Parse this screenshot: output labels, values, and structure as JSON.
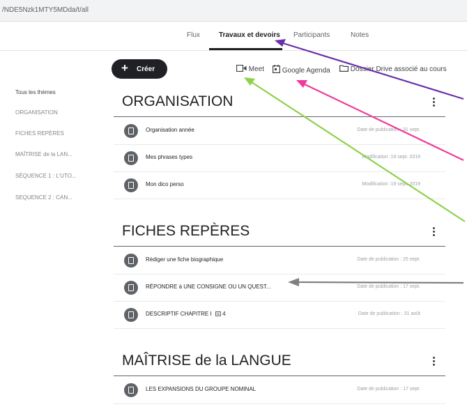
{
  "browser": {
    "url": "/NDE5Nzk1MTY5MDda/t/all"
  },
  "tabs": [
    {
      "label": "Flux"
    },
    {
      "label": "Travaux et devoirs"
    },
    {
      "label": "Participants"
    },
    {
      "label": "Notes"
    }
  ],
  "toolbar": {
    "create_label": "Créer",
    "meet_label": "Meet",
    "agenda_label": "Google Agenda",
    "drive_label": "Dossier Drive associé au cours"
  },
  "sidebar": {
    "items": [
      {
        "label": "Tous les thèmes"
      },
      {
        "label": "ORGANISATION"
      },
      {
        "label": "FICHES REPÈRES"
      },
      {
        "label": "MAÎTRISE de la LAN..."
      },
      {
        "label": "SÉQUENCE 1 : L'UTO..."
      },
      {
        "label": "SEQUENCE 2 : CAN..."
      }
    ]
  },
  "sections": [
    {
      "title": "ORGANISATION",
      "rows": [
        {
          "title": "Organisation année",
          "date": "Date de publication : 31 sept."
        },
        {
          "title": "Mes phrases types",
          "date": "Modification :19 sept. 2019"
        },
        {
          "title": "Mon dico perso",
          "date": "Modification :19 sept. 2019"
        }
      ]
    },
    {
      "title": "FICHES REPÈRES",
      "rows": [
        {
          "title": "Rédiger une fiche biographique",
          "date": "Date de publication : 25 sept."
        },
        {
          "title": "RÉPONDRE à UNE CONSIGNE OU UN QUEST...",
          "date": "Date de publication : 17 sept."
        },
        {
          "title": "DESCRIPTIF CHAPITRE I",
          "extra": "4",
          "date": "Date de publication : 31 août"
        }
      ]
    },
    {
      "title": "MAÎTRISE de la LANGUE",
      "rows": [
        {
          "title": "LES EXPANSIONS DU GROUPE NOMINAL",
          "date": "Date de publication : 17 sept."
        }
      ]
    }
  ],
  "colors": {
    "arrow_purple": "#6a2fa8",
    "arrow_pink": "#f0399a",
    "arrow_green": "#8ed14a",
    "arrow_gray": "#808080"
  }
}
